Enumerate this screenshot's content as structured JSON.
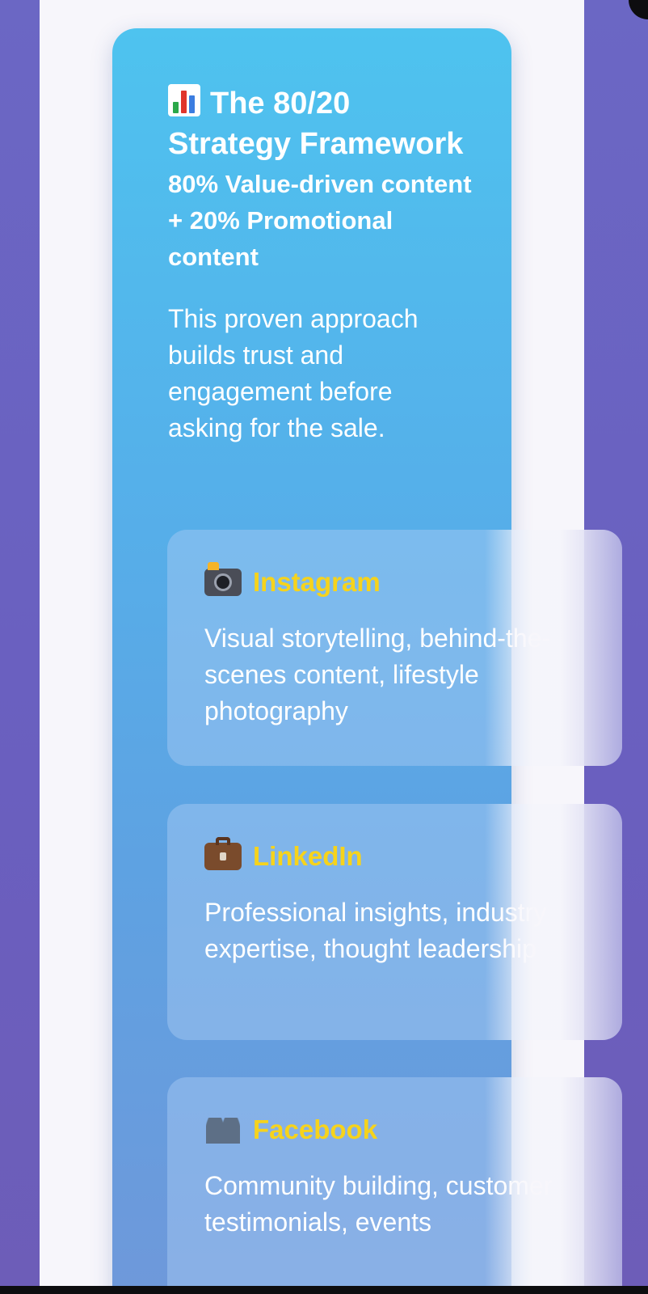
{
  "hero": {
    "title": "The 80/20 Strategy Framework",
    "subtitle": "80% Value-driven content + 20% Promotional content",
    "description": "This proven approach builds trust and engagement before asking for the sale.",
    "icon": "bar-chart-icon"
  },
  "platforms": [
    {
      "name": "Instagram",
      "description": "Visual storytelling, behind-the-scenes content, lifestyle photography",
      "icon": "camera-flash-icon"
    },
    {
      "name": "LinkedIn",
      "description": "Professional insights, industry expertise, thought leadership",
      "icon": "briefcase-icon"
    },
    {
      "name": "Facebook",
      "description": "Community building, customer testimonials, events",
      "icon": "people-icon"
    }
  ],
  "colors": {
    "accent": "#f6d31c",
    "background": "#6b67c4",
    "panel": "#f7f6fb",
    "card_gradient_top": "#4ec3ef",
    "card_gradient_bottom": "#6f98da"
  }
}
